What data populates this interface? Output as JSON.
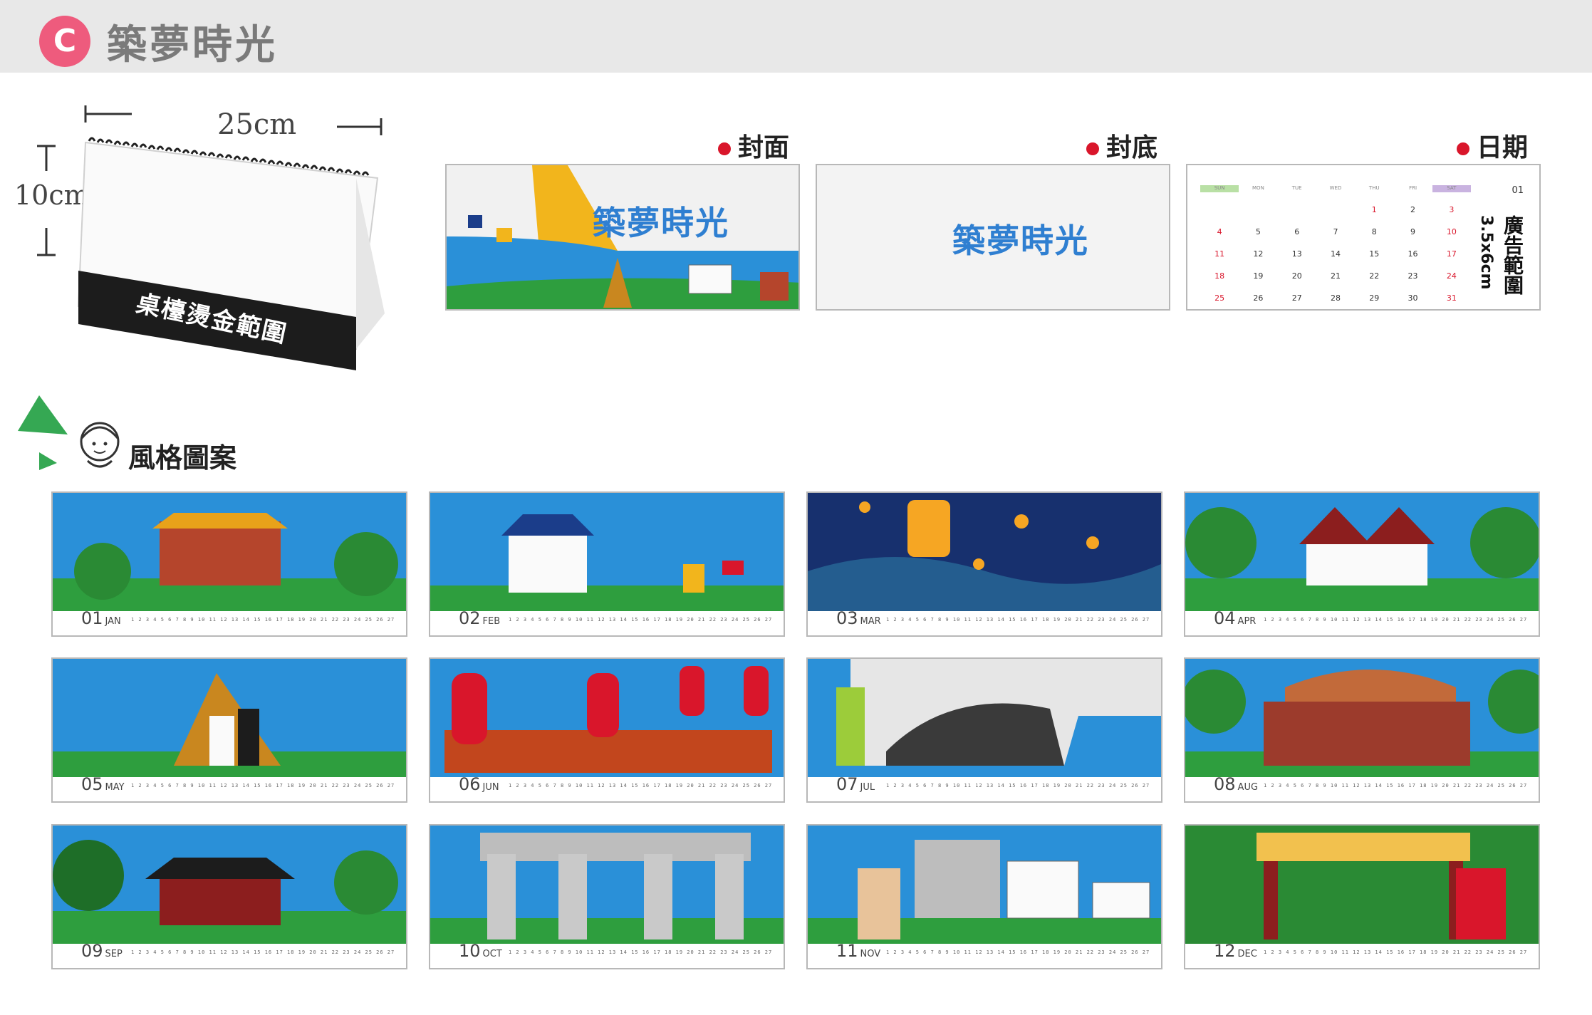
{
  "header": {
    "badge": "C",
    "title": "築夢時光"
  },
  "mock": {
    "width_label": "25cm",
    "height_label": "10cm",
    "gold_label": "桌檯燙金範圍"
  },
  "previews": {
    "cover": {
      "label": "封面",
      "logo": "築夢時光"
    },
    "back": {
      "label": "封底",
      "logo": "築夢時光"
    },
    "date": {
      "label": "日期",
      "month_id": "01",
      "ad_range": "廣告範圍",
      "ad_size": "3.5x6cm",
      "weekdays": [
        "SUN",
        "MON",
        "TUE",
        "WED",
        "THU",
        "FRI",
        "SAT"
      ],
      "weeks": [
        [
          "",
          "",
          "",
          "",
          "1",
          "2",
          "3"
        ],
        [
          "4",
          "5",
          "6",
          "7",
          "8",
          "9",
          "10"
        ],
        [
          "11",
          "12",
          "13",
          "14",
          "15",
          "16",
          "17"
        ],
        [
          "18",
          "19",
          "20",
          "21",
          "22",
          "23",
          "24"
        ],
        [
          "25",
          "26",
          "27",
          "28",
          "29",
          "30",
          "31"
        ]
      ]
    }
  },
  "style_heading": "風格圖案",
  "months": [
    {
      "num": "01",
      "abbr": "JAN"
    },
    {
      "num": "02",
      "abbr": "FEB"
    },
    {
      "num": "03",
      "abbr": "MAR"
    },
    {
      "num": "04",
      "abbr": "APR"
    },
    {
      "num": "05",
      "abbr": "MAY"
    },
    {
      "num": "06",
      "abbr": "JUN"
    },
    {
      "num": "07",
      "abbr": "JUL"
    },
    {
      "num": "08",
      "abbr": "AUG"
    },
    {
      "num": "09",
      "abbr": "SEP"
    },
    {
      "num": "10",
      "abbr": "OCT"
    },
    {
      "num": "11",
      "abbr": "NOV"
    },
    {
      "num": "12",
      "abbr": "DEC"
    }
  ],
  "colors": {
    "badge": "#ee5b7d",
    "dot": "#d9162b",
    "sky": "#2a90d8",
    "grass": "#2e9e3e"
  }
}
